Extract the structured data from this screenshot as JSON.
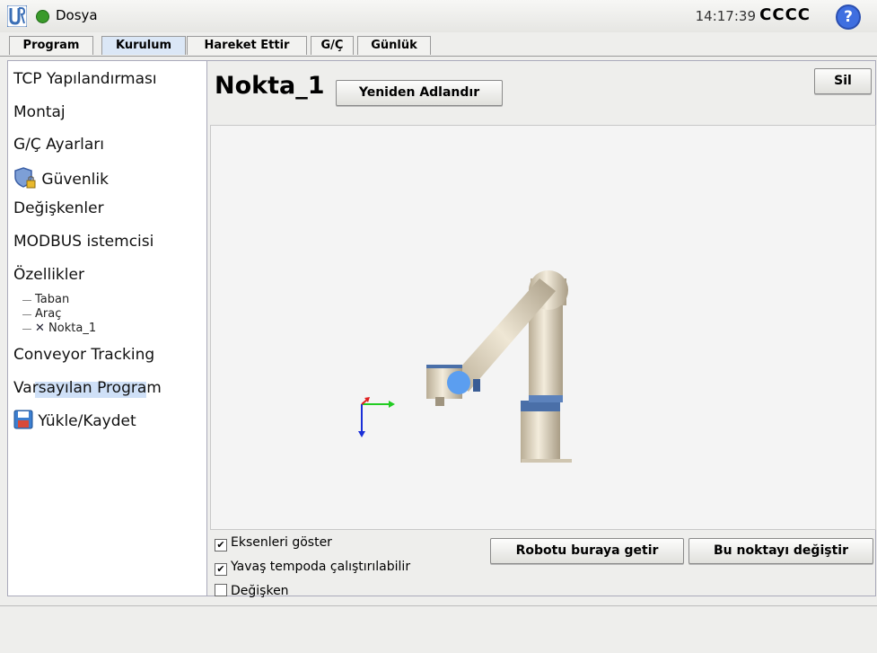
{
  "header": {
    "menu_label": "Dosya",
    "clock": "14:17:39",
    "robot_name": "CCCC",
    "help_symbol": "?"
  },
  "tabs": [
    "Program",
    "Kurulum",
    "Hareket Ettir",
    "G/Ç",
    "Günlük"
  ],
  "sidebar": {
    "items": [
      "TCP Yapılandırması",
      "Montaj",
      "G/Ç Ayarları",
      "Güvenlik",
      "Değişkenler",
      "MODBUS istemcisi",
      "Özellikler",
      "Conveyor Tracking",
      "Varsayılan Program",
      "Yükle/Kaydet"
    ],
    "features": [
      "Taban",
      "Araç",
      "Nokta_1"
    ]
  },
  "main": {
    "title": "Nokta_1",
    "rename_button": "Yeniden Adlandır",
    "delete_button": "Sil",
    "checkboxes": [
      {
        "label": "Eksenleri göster",
        "checked": true
      },
      {
        "label": "Yavaş tempoda çalıştırılabilir",
        "checked": true
      },
      {
        "label": "Değişken",
        "checked": false
      }
    ],
    "move_here_button": "Robotu buraya getir",
    "change_point_button": "Bu noktayı değiştir"
  }
}
